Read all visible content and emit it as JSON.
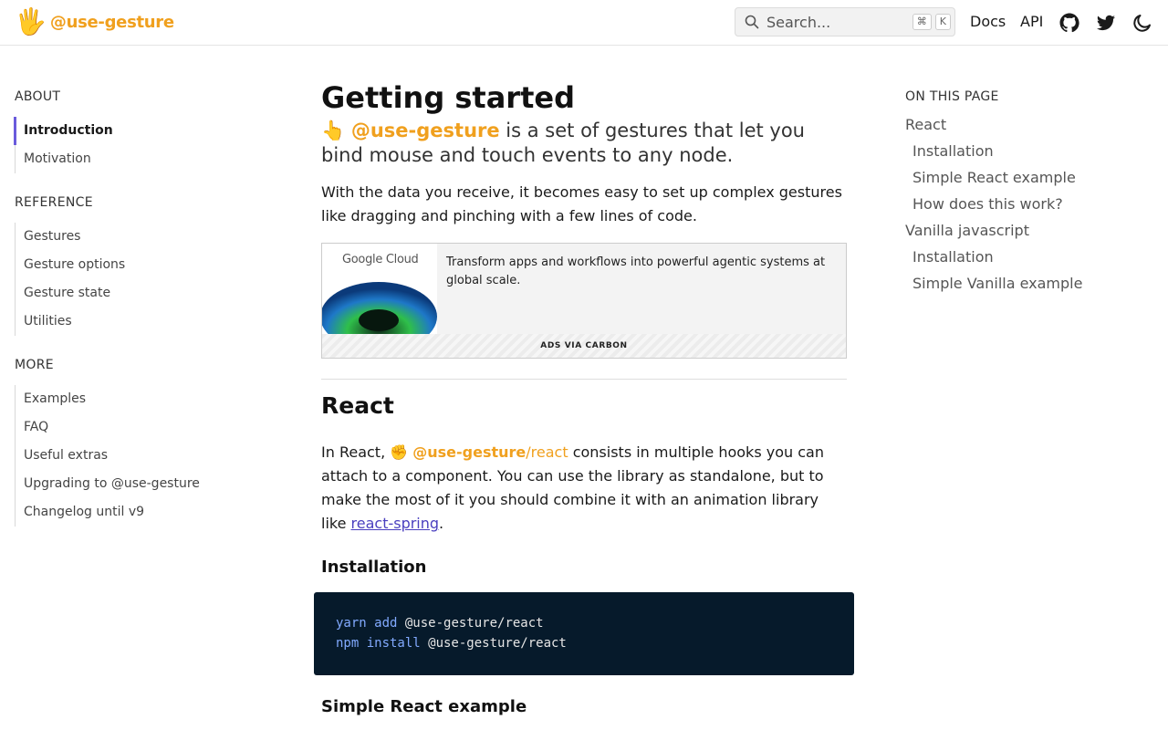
{
  "header": {
    "logo_emoji": "🖐",
    "logo_text": "@use-gesture",
    "search_placeholder": "Search...",
    "search_kbd_1": "⌘",
    "search_kbd_2": "K",
    "nav_docs": "Docs",
    "nav_api": "API",
    "icons": [
      "github-icon",
      "twitter-icon",
      "moon-icon"
    ]
  },
  "sidebar": {
    "sections": [
      {
        "title": "ABOUT",
        "items": [
          "Introduction",
          "Motivation"
        ]
      },
      {
        "title": "REFERENCE",
        "items": [
          "Gestures",
          "Gesture options",
          "Gesture state",
          "Utilities"
        ]
      },
      {
        "title": "MORE",
        "items": [
          "Examples",
          "FAQ",
          "Useful extras",
          "Upgrading to @use-gesture",
          "Changelog until v9"
        ]
      }
    ],
    "active_item": "Introduction"
  },
  "main": {
    "title": "Getting started",
    "lead_emoji": "👆",
    "lead_brand": "@use-gesture",
    "lead_rest": " is a set of gestures that let you bind mouse and touch events to any node.",
    "intro_paragraph": "With the data you receive, it becomes easy to set up complex gestures like dragging and pinching with a few lines of code.",
    "ad": {
      "brand": "Google Cloud",
      "text": "Transform apps and workflows into powerful agentic systems at global scale.",
      "footer": "ADS VIA CARBON"
    },
    "react_heading": "React",
    "react_para_prefix": "In React, ",
    "react_emoji": "✊",
    "react_pkg_bold": "@use-gesture",
    "react_pkg_rest": "/react",
    "react_para_mid": " consists in multiple hooks you can attach to a component. You can use the library as standalone, but to make the most of it you should combine it with an animation library like ",
    "react_link": "react-spring",
    "react_para_end": ".",
    "installation_heading": "Installation",
    "code_lines": [
      {
        "cmd": "yarn add",
        "arg": " @use-gesture/react"
      },
      {
        "cmd": "npm install",
        "arg": " @use-gesture/react"
      }
    ],
    "simple_heading": "Simple React example"
  },
  "toc": {
    "title": "ON THIS PAGE",
    "items": [
      {
        "label": "React",
        "sub": false
      },
      {
        "label": "Installation",
        "sub": true
      },
      {
        "label": "Simple React example",
        "sub": true
      },
      {
        "label": "How does this work?",
        "sub": true
      },
      {
        "label": "Vanilla javascript",
        "sub": false
      },
      {
        "label": "Installation",
        "sub": true
      },
      {
        "label": "Simple Vanilla example",
        "sub": true
      }
    ]
  },
  "colors": {
    "brand_orange": "#f0a01e",
    "accent_purple": "#6a5bdc",
    "code_bg": "#061a2b"
  }
}
